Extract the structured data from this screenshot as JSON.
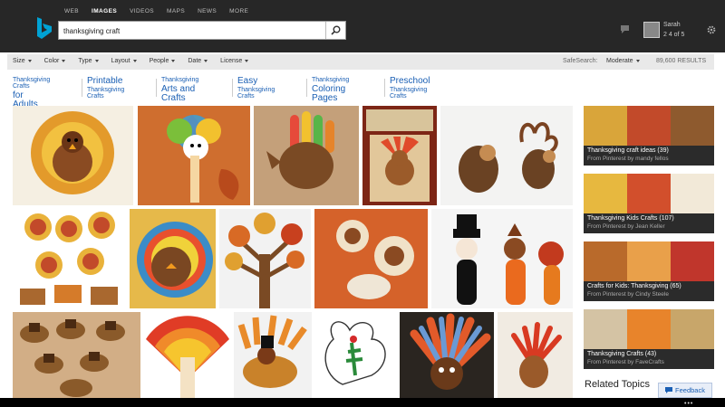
{
  "header": {
    "verticals": [
      "WEB",
      "IMAGES",
      "VIDEOS",
      "MAPS",
      "NEWS",
      "MORE"
    ],
    "active_vertical": "IMAGES",
    "search_query": "thanksgiving craft",
    "user_name": "Sarah",
    "rewards": "2 4 of 5"
  },
  "filters": {
    "items": [
      "Size",
      "Color",
      "Type",
      "Layout",
      "People",
      "Date",
      "License"
    ],
    "safesearch_label": "SafeSearch:",
    "safesearch_value": "Moderate",
    "results_count": "89,600 RESULTS"
  },
  "related_searches": [
    {
      "small": "Thanksgiving Crafts",
      "big": "for Adults",
      "order": "small-first"
    },
    {
      "big": "Printable",
      "small": "Thanksgiving Crafts",
      "order": "big-first"
    },
    {
      "small": "Thanksgiving",
      "big": "Arts and Crafts",
      "order": "small-first"
    },
    {
      "big": "Easy",
      "small": "Thanksgiving Crafts",
      "order": "big-first"
    },
    {
      "small": "Thanksgiving",
      "big": "Coloring Pages",
      "order": "small-first"
    },
    {
      "big": "Preschool",
      "small": "Thanksgiving Crafts",
      "order": "big-first"
    }
  ],
  "albums": [
    {
      "title": "Thanksgiving craft ideas (39)",
      "source": "From Pinterest by mandy fellos",
      "colors": [
        "#d9a53a",
        "#c24a2a",
        "#8e5a2e"
      ]
    },
    {
      "title": "Thanksgiving Kids Crafts (107)",
      "source": "From Pinterest by Jean Keller",
      "colors": [
        "#e7b83f",
        "#d24f2c",
        "#f2e9d8"
      ]
    },
    {
      "title": "Crafts for Kids: Thanksgiving (65)",
      "source": "From Pinterest by Cindy Steele",
      "colors": [
        "#b96a2b",
        "#e9a04a",
        "#c0362c"
      ]
    },
    {
      "title": "Thanksgiving Crafts (43)",
      "source": "From Pinterest by FaveCrafts",
      "colors": [
        "#d4c3a4",
        "#e8842b",
        "#c8a66a"
      ]
    }
  ],
  "related_topics_label": "Related Topics",
  "feedback_label": "Feedback",
  "colors": {
    "accent": "#1a5fb4",
    "header_bg": "#272727",
    "bing_logo": "#00a2d4"
  }
}
